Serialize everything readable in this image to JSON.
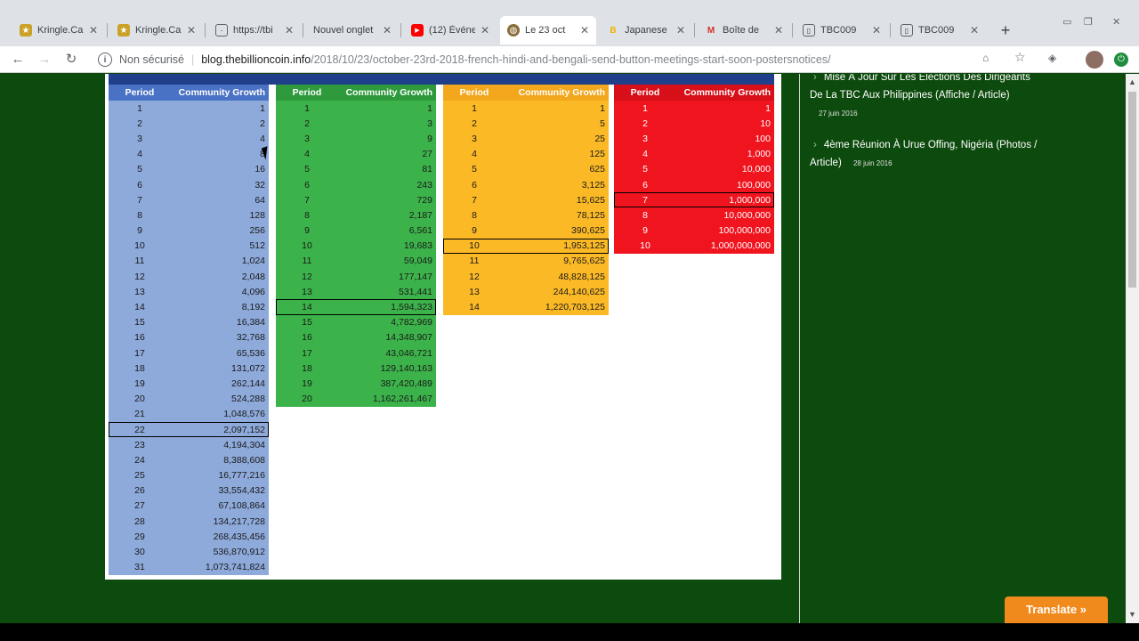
{
  "tabs": [
    {
      "title": "Kringle.Ca",
      "active": false
    },
    {
      "title": "Kringle.Ca",
      "active": false
    },
    {
      "title": "https://tbi",
      "active": false
    },
    {
      "title": "Nouvel onglet",
      "active": false
    },
    {
      "title": "(12) Événe",
      "active": false
    },
    {
      "title": "Le 23 oct",
      "active": true
    },
    {
      "title": "Japanese",
      "active": false
    },
    {
      "title": "Boîte de",
      "active": false
    },
    {
      "title": "TBC009",
      "active": false
    },
    {
      "title": "TBC009",
      "active": false
    }
  ],
  "omnibox": {
    "security_label": "Non sécurisé",
    "host": "blog.thebillioncoin.info",
    "path": "/2018/10/23/october-23rd-2018-french-hindi-and-bengali-send-button-meetings-start-soon-postersnotices/"
  },
  "table_headers": {
    "period": "Period",
    "growth": "Community Growth"
  },
  "tables": {
    "blue": {
      "highlight": 22,
      "rows": [
        [
          "1",
          "1"
        ],
        [
          "2",
          "2"
        ],
        [
          "3",
          "4"
        ],
        [
          "4",
          "8"
        ],
        [
          "5",
          "16"
        ],
        [
          "6",
          "32"
        ],
        [
          "7",
          "64"
        ],
        [
          "8",
          "128"
        ],
        [
          "9",
          "256"
        ],
        [
          "10",
          "512"
        ],
        [
          "11",
          "1,024"
        ],
        [
          "12",
          "2,048"
        ],
        [
          "13",
          "4,096"
        ],
        [
          "14",
          "8,192"
        ],
        [
          "15",
          "16,384"
        ],
        [
          "16",
          "32,768"
        ],
        [
          "17",
          "65,536"
        ],
        [
          "18",
          "131,072"
        ],
        [
          "19",
          "262,144"
        ],
        [
          "20",
          "524,288"
        ],
        [
          "21",
          "1,048,576"
        ],
        [
          "22",
          "2,097,152"
        ],
        [
          "23",
          "4,194,304"
        ],
        [
          "24",
          "8,388,608"
        ],
        [
          "25",
          "16,777,216"
        ],
        [
          "26",
          "33,554,432"
        ],
        [
          "27",
          "67,108,864"
        ],
        [
          "28",
          "134,217,728"
        ],
        [
          "29",
          "268,435,456"
        ],
        [
          "30",
          "536,870,912"
        ],
        [
          "31",
          "1,073,741,824"
        ]
      ]
    },
    "green": {
      "highlight": 14,
      "rows": [
        [
          "1",
          "1"
        ],
        [
          "2",
          "3"
        ],
        [
          "3",
          "9"
        ],
        [
          "4",
          "27"
        ],
        [
          "5",
          "81"
        ],
        [
          "6",
          "243"
        ],
        [
          "7",
          "729"
        ],
        [
          "8",
          "2,187"
        ],
        [
          "9",
          "6,561"
        ],
        [
          "10",
          "19,683"
        ],
        [
          "11",
          "59,049"
        ],
        [
          "12",
          "177,147"
        ],
        [
          "13",
          "531,441"
        ],
        [
          "14",
          "1,594,323"
        ],
        [
          "15",
          "4,782,969"
        ],
        [
          "16",
          "14,348,907"
        ],
        [
          "17",
          "43,046,721"
        ],
        [
          "18",
          "129,140,163"
        ],
        [
          "19",
          "387,420,489"
        ],
        [
          "20",
          "1,162,261,467"
        ]
      ]
    },
    "orange": {
      "highlight": 10,
      "rows": [
        [
          "1",
          "1"
        ],
        [
          "2",
          "5"
        ],
        [
          "3",
          "25"
        ],
        [
          "4",
          "125"
        ],
        [
          "5",
          "625"
        ],
        [
          "6",
          "3,125"
        ],
        [
          "7",
          "15,625"
        ],
        [
          "8",
          "78,125"
        ],
        [
          "9",
          "390,625"
        ],
        [
          "10",
          "1,953,125"
        ],
        [
          "11",
          "9,765,625"
        ],
        [
          "12",
          "48,828,125"
        ],
        [
          "13",
          "244,140,625"
        ],
        [
          "14",
          "1,220,703,125"
        ]
      ]
    },
    "red": {
      "highlight": 7,
      "rows": [
        [
          "1",
          "1"
        ],
        [
          "2",
          "10"
        ],
        [
          "3",
          "100"
        ],
        [
          "4",
          "1,000"
        ],
        [
          "5",
          "10,000"
        ],
        [
          "6",
          "100,000"
        ],
        [
          "7",
          "1,000,000"
        ],
        [
          "8",
          "10,000,000"
        ],
        [
          "9",
          "100,000,000"
        ],
        [
          "10",
          "1,000,000,000"
        ]
      ]
    }
  },
  "sidebar": {
    "items": [
      {
        "title": "Mise À Jour Sur Les Élections Des Dirigeants De La TBC Aux Philippines (Affiche / Article)",
        "date": "27 juin 2016"
      },
      {
        "title": "4ème Réunion À Urue Offing, Nigéria (Photos / Article)",
        "date": "28 juin 2016"
      }
    ]
  },
  "translate_label": "Translate »",
  "colors": {
    "blue": "#8eaadb",
    "green": "#3cb34a",
    "orange": "#fbb926",
    "red": "#f0141e",
    "page_bg": "#0d4a0d"
  }
}
